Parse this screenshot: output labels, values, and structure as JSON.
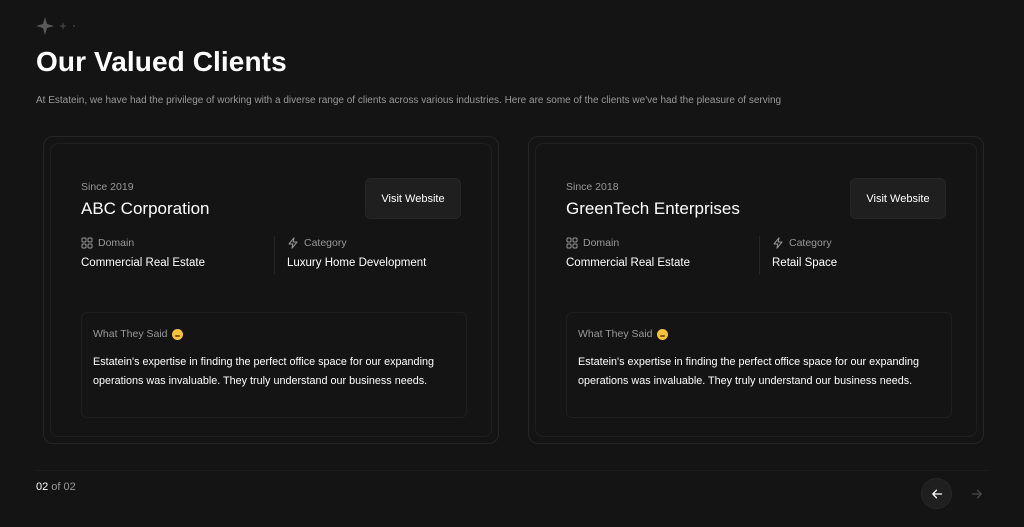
{
  "header": {
    "title": "Our Valued Clients",
    "description": "At Estatein, we have had the privilege of working with a diverse range of clients across various industries. Here are some of the clients we've had the pleasure of serving",
    "decoration_icon": "sparkles-icon"
  },
  "clients": [
    {
      "since": "Since 2019",
      "name": "ABC Corporation",
      "visit_label": "Visit Website",
      "domain_label": "Domain",
      "domain_value": "Commercial Real Estate",
      "category_label": "Category",
      "category_value": "Luxury Home Development",
      "quote_label": "What They Said",
      "quote": "Estatein's expertise in finding the perfect office space for our expanding operations was invaluable. They truly understand our business needs."
    },
    {
      "since": "Since 2018",
      "name": "GreenTech Enterprises",
      "visit_label": "Visit Website",
      "domain_label": "Domain",
      "domain_value": "Commercial Real Estate",
      "category_label": "Category",
      "category_value": "Retail Space",
      "quote_label": "What They Said",
      "quote": "Estatein's expertise in finding the perfect office space for our expanding operations was invaluable. They truly understand our business needs."
    }
  ],
  "pager": {
    "current": "02",
    "rest": " of 02"
  },
  "icons": {
    "domain": "grid-icon",
    "category": "lightning-icon",
    "quote": "hugging-face-emoji-icon",
    "prev": "arrow-left-icon",
    "next": "arrow-right-icon"
  },
  "colors": {
    "background": "#141414",
    "card_border": "#262626",
    "muted_text": "#999999",
    "button_bg": "#1f1f1f"
  }
}
